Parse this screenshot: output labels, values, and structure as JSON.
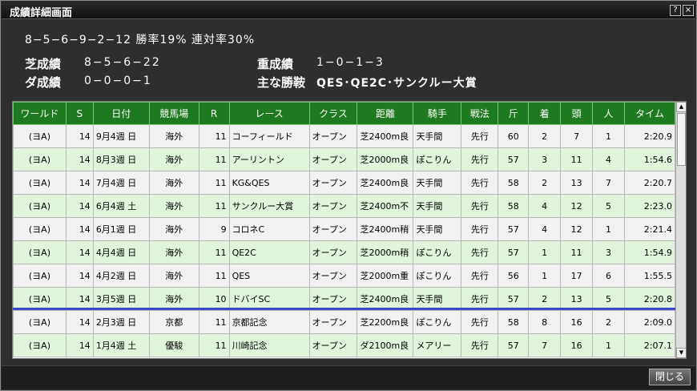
{
  "window": {
    "title": "成績詳細画面",
    "help_label": "?",
    "close_label": "×"
  },
  "summary": {
    "record_line": "8−5−6−9−2−12 勝率19% 連対率30%",
    "turf_label": "芝成績",
    "turf_value": "8−5−6−22",
    "dirt_label": "ダ成績",
    "dirt_value": "0−0−0−1",
    "heavy_label": "重成績",
    "heavy_value": "1−0−1−3",
    "wins_label": "主な勝鞍",
    "wins_value": "QES･QE2C･サンクルー大賞"
  },
  "table": {
    "headers": [
      "ワールド",
      "S",
      "日付",
      "競馬場",
      "R",
      "レース",
      "クラス",
      "距離",
      "騎手",
      "戦法",
      "斤",
      "着",
      "頭",
      "人",
      "タイム"
    ],
    "rows": [
      [
        "(ヨA)",
        "14",
        "9月4週 日",
        "海外",
        "11",
        "コーフィールド",
        "オープン",
        "芝2400m良",
        "天手間",
        "先行",
        "60",
        "2",
        "7",
        "1",
        "2:20.9"
      ],
      [
        "(ヨA)",
        "14",
        "8月3週 日",
        "海外",
        "11",
        "アーリントン",
        "オープン",
        "芝2000m良",
        "ぽこりん",
        "先行",
        "57",
        "3",
        "11",
        "4",
        "1:54.6"
      ],
      [
        "(ヨA)",
        "14",
        "7月4週 日",
        "海外",
        "11",
        "KG&QES",
        "オープン",
        "芝2400m良",
        "天手間",
        "先行",
        "58",
        "2",
        "13",
        "7",
        "2:20.7"
      ],
      [
        "(ヨA)",
        "14",
        "6月4週 土",
        "海外",
        "11",
        "サンクルー大賞",
        "オープン",
        "芝2400m不",
        "天手間",
        "先行",
        "58",
        "4",
        "12",
        "5",
        "2:23.0"
      ],
      [
        "(ヨA)",
        "14",
        "6月1週 日",
        "海外",
        "9",
        "コロネC",
        "オープン",
        "芝2400m稍",
        "天手間",
        "先行",
        "57",
        "4",
        "12",
        "1",
        "2:21.4"
      ],
      [
        "(ヨA)",
        "14",
        "4月4週 日",
        "海外",
        "11",
        "QE2C",
        "オープン",
        "芝2000m稍",
        "ぽこりん",
        "先行",
        "57",
        "1",
        "11",
        "3",
        "1:54.9"
      ],
      [
        "(ヨA)",
        "14",
        "4月2週 日",
        "海外",
        "11",
        "QES",
        "オープン",
        "芝2000m重",
        "ぽこりん",
        "先行",
        "56",
        "1",
        "17",
        "6",
        "1:55.5"
      ],
      [
        "(ヨA)",
        "14",
        "3月5週 日",
        "海外",
        "10",
        "ドバイSC",
        "オープン",
        "芝2400m良",
        "天手間",
        "先行",
        "57",
        "2",
        "13",
        "5",
        "2:20.8"
      ],
      [
        "(ヨA)",
        "14",
        "2月3週 日",
        "京都",
        "11",
        "京都記念",
        "オープン",
        "芝2200m良",
        "ぽこりん",
        "先行",
        "58",
        "8",
        "16",
        "2",
        "2:09.0"
      ],
      [
        "(ヨA)",
        "14",
        "1月4週 土",
        "優駿",
        "11",
        "川崎記念",
        "オープン",
        "ダ2100m良",
        "メアリー",
        "先行",
        "57",
        "7",
        "16",
        "1",
        "2:07.1"
      ]
    ]
  },
  "scrollbar": {
    "up_label": "▲",
    "down_label": "▼"
  },
  "footer": {
    "close_button_label": "閉じる"
  }
}
